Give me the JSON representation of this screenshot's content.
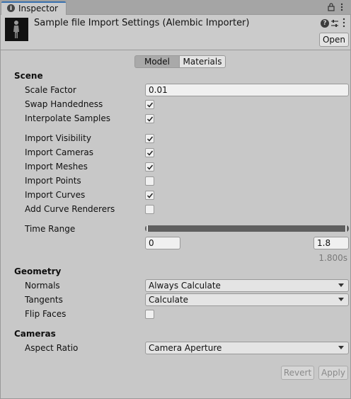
{
  "tab": {
    "title": "Inspector"
  },
  "header": {
    "title": "Sample file Import Settings (Alembic Importer)",
    "open_label": "Open"
  },
  "mode_tabs": {
    "model": "Model",
    "materials": "Materials",
    "selected": "Model"
  },
  "scene": {
    "heading": "Scene",
    "scale_factor_label": "Scale Factor",
    "scale_factor_value": "0.01",
    "swap_handedness_label": "Swap Handedness",
    "swap_handedness": true,
    "interpolate_samples_label": "Interpolate Samples",
    "interpolate_samples": true,
    "import_visibility_label": "Import Visibility",
    "import_visibility": true,
    "import_cameras_label": "Import Cameras",
    "import_cameras": true,
    "import_meshes_label": "Import Meshes",
    "import_meshes": true,
    "import_points_label": "Import Points",
    "import_points": false,
    "import_curves_label": "Import Curves",
    "import_curves": true,
    "add_curve_renderers_label": "Add Curve Renderers",
    "add_curve_renderers": false,
    "time_range_label": "Time Range",
    "time_range_start": "0",
    "time_range_end": "1.8",
    "duration": "1.800s"
  },
  "geometry": {
    "heading": "Geometry",
    "normals_label": "Normals",
    "normals_value": "Always Calculate",
    "tangents_label": "Tangents",
    "tangents_value": "Calculate",
    "flip_faces_label": "Flip Faces",
    "flip_faces": false
  },
  "cameras": {
    "heading": "Cameras",
    "aspect_ratio_label": "Aspect Ratio",
    "aspect_ratio_value": "Camera Aperture"
  },
  "footer": {
    "revert_label": "Revert",
    "apply_label": "Apply"
  },
  "colors": {
    "accent": "#3a72b0",
    "panel_bg": "#c8c8c8",
    "slider": "#5f5f5f"
  },
  "icons": [
    "info-icon",
    "lock-icon",
    "menu-icon",
    "help-icon",
    "settings-icon",
    "more-icon",
    "checkmark-icon",
    "chevron-down-icon"
  ]
}
